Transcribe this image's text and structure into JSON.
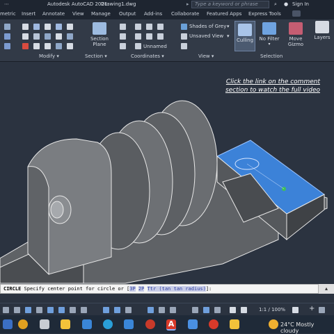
{
  "titlebar": {
    "app_title": "Autodesk AutoCAD 2021",
    "file_name": "Drawing1.dwg",
    "search_placeholder": "Type a keyword or phrase",
    "sign_in": "Sign In"
  },
  "tabs": [
    "metric",
    "Insert",
    "Annotate",
    "View",
    "Manage",
    "Output",
    "Add-ins",
    "Collaborate",
    "Featured Apps",
    "Express Tools"
  ],
  "ribbon": {
    "modify_label": "Modify",
    "section_label": "Section",
    "section_plane_label": "Section Plane",
    "coordinates_label": "Coordinates",
    "unnamed_label": "Unnamed",
    "view_label": "View",
    "visual_style": "Shades of Grey",
    "unsaved_view": "Unsaved View",
    "culling_label": "Culling",
    "no_filter_label": "No Filter",
    "move_gizmo_label": "Move Gizmo",
    "selection_label": "Selection",
    "layers_label": "Layers"
  },
  "overlay_note": "Click the link on the comment section to watch the full video",
  "command_line": {
    "command": "CIRCLE",
    "prompt": " Specify center point for circle or [",
    "opt_3p": "3P",
    "opt_2p": "2P",
    "opt_ttr": "Ttr (tan tan radius)",
    "closing": "]:"
  },
  "statusbar": {
    "scale": "1:1 / 100%"
  },
  "taskbar": {
    "weather": "24°C  Mostly cloudy"
  },
  "colors": {
    "selection_blue": "#3c82d8",
    "background": "#2b3340"
  }
}
